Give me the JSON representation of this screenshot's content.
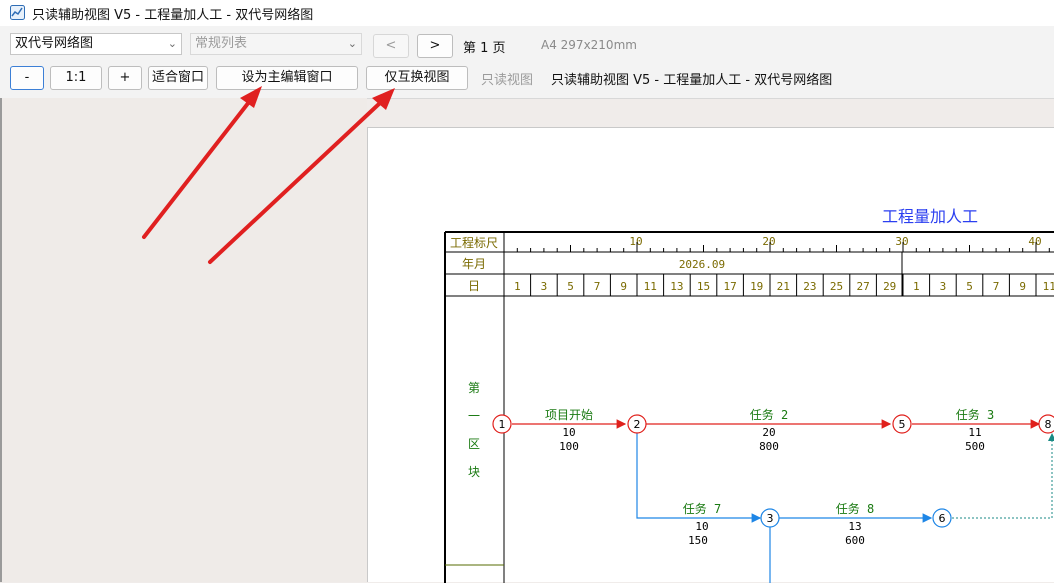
{
  "window": {
    "title": "只读辅助视图 V5 - 工程量加人工 - 双代号网络图"
  },
  "toolbar": {
    "view_select": "双代号网络图",
    "list_select": "常规列表",
    "prev_label": "<",
    "next_label": ">",
    "page_label": "第 1 页",
    "paper_label": "A4 297x210mm",
    "zoom_out": "-",
    "zoom_reset": "1:1",
    "zoom_in": "+",
    "fit_window": "适合窗口",
    "set_main": "设为主编辑窗口",
    "swap_only": "仅互换视图",
    "readonly_label": "只读视图",
    "view_caption": "只读辅助视图 V5 - 工程量加人工 - 双代号网络图"
  },
  "diagram": {
    "title": "工程量加人工",
    "scale_label": "工程标尺",
    "month_label": "年月",
    "day_label": "日",
    "month_value": "2026.09",
    "scale_numbers": [
      "10",
      "20",
      "30",
      "40"
    ],
    "days": [
      "1",
      "3",
      "5",
      "7",
      "9",
      "11",
      "13",
      "15",
      "17",
      "19",
      "21",
      "23",
      "25",
      "27",
      "29",
      "1",
      "3",
      "5",
      "7",
      "9",
      "11"
    ],
    "section_label": [
      "第",
      "一",
      "区",
      "块"
    ],
    "nodes": [
      "1",
      "2",
      "5",
      "8",
      "3",
      "6"
    ],
    "tasks": [
      {
        "name": "项目开始",
        "duration": "10",
        "quantity": "100"
      },
      {
        "name": "任务 2",
        "duration": "20",
        "quantity": "800"
      },
      {
        "name": "任务 3",
        "duration": "11",
        "quantity": "500"
      },
      {
        "name": "任务 7",
        "duration": "10",
        "quantity": "150"
      },
      {
        "name": "任务 8",
        "duration": "13",
        "quantity": "600"
      }
    ],
    "colors": {
      "critical": "#e0201c",
      "normal": "#1e86e6",
      "dummy": "#1a8a84",
      "text_green": "#1a7a12",
      "title_blue": "#2b3ff0",
      "header_olive": "#7a6a00"
    }
  }
}
